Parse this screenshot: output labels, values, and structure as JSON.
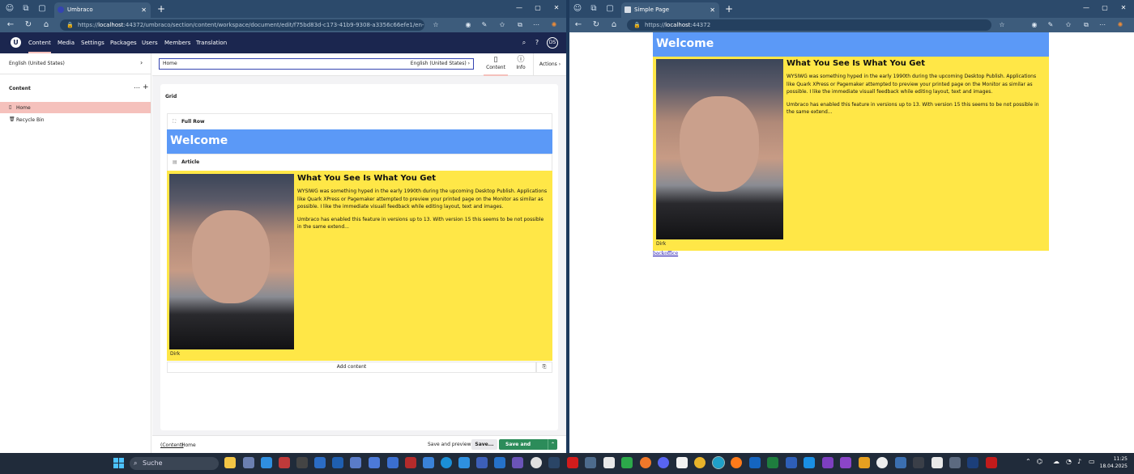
{
  "left_window": {
    "tab_title": "Umbraco",
    "url_host": "localhost",
    "url_rest": ":44372/umbraco/section/content/workspace/document/edit/f75bd83d-c173-41b9-9308-a3356c66efe1/en-US/tab/..."
  },
  "right_window": {
    "tab_title": "Simple Page",
    "url_prefix": "https://",
    "url_host": "localhost",
    "url_rest": ":44372"
  },
  "umbraco": {
    "nav": [
      "Content",
      "Media",
      "Settings",
      "Packages",
      "Users",
      "Members",
      "Translation"
    ],
    "avatar": "DS",
    "culture": "English (United States)",
    "tree_title": "Content",
    "tree_items": [
      "Home",
      "Recycle Bin"
    ],
    "doc_name": "Home",
    "doc_culture": "English (United States)",
    "workspace_tabs": [
      "Content",
      "Info"
    ],
    "actions_label": "Actions",
    "grid_label": "Grid",
    "full_row_label": "Full Row",
    "article_label": "Article",
    "add_content": "Add content",
    "breadcrumb_root": "(Content)",
    "breadcrumb_current": "Home",
    "save_preview": "Save and preview",
    "save": "Save...",
    "save_publish": "Save and publish..."
  },
  "page": {
    "welcome": "Welcome",
    "article_title": "What You See Is What You Get",
    "paragraph1": "WYSIWG was something hyped in the early 1990th during the upcoming Desktop Publish. Applications like Quark XPress or Pagemaker attempted to preview your printed page on the Monitor as similar as possible. I like the immediate visuall feedback while editing layout, text and images.",
    "paragraph2": "Umbraco has enabled this feature in versions up to 13. With version 15 this seems to be not possible in the same extend...",
    "caption": "Dirk",
    "link": "backoffice"
  },
  "taskbar": {
    "search_label": "Suche",
    "time": "11:25",
    "date": "18.04.2025"
  },
  "colors": {
    "umbraco_header": "#1b264f",
    "selected_tree": "#f5c1bc",
    "welcome_bg": "#5b99f7",
    "article_bg": "#ffe747",
    "publish_button": "#2c8c5a"
  }
}
